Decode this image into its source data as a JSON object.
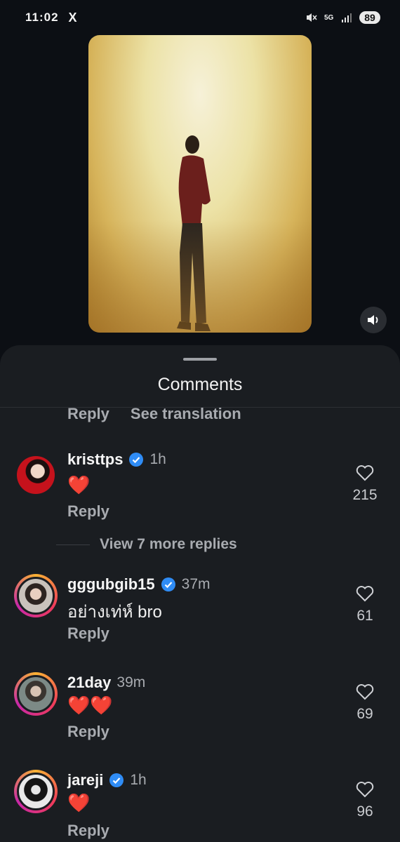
{
  "status_bar": {
    "time": "11:02",
    "app_icon": "x-logo",
    "x_label": "X",
    "network": "5G",
    "battery": "89"
  },
  "media": {
    "description_icon": "video-frame",
    "sound_icon": "speaker-icon"
  },
  "sheet": {
    "title": "Comments",
    "top_actions": {
      "reply": "Reply",
      "see_translation": "See translation"
    }
  },
  "comments": [
    {
      "username": "kristtps",
      "verified": true,
      "time": "1h",
      "text": "❤️",
      "reply": "Reply",
      "likes": "215"
    },
    {
      "username": "gggubgib15",
      "verified": true,
      "time": "37m",
      "text": "อย่างเท่ห์ bro",
      "reply": "Reply",
      "likes": "61"
    },
    {
      "username": "21day",
      "verified": false,
      "time": "39m",
      "text": "❤️❤️",
      "reply": "Reply",
      "likes": "69"
    },
    {
      "username": "jareji",
      "verified": true,
      "time": "1h",
      "text": "❤️",
      "reply": "Reply",
      "likes": "96"
    }
  ],
  "view_more": "View 7 more replies",
  "colors": {
    "accent_verified": "#2f8cf5",
    "heart": "#ff3e6c",
    "sheet_bg": "#1a1d21"
  }
}
